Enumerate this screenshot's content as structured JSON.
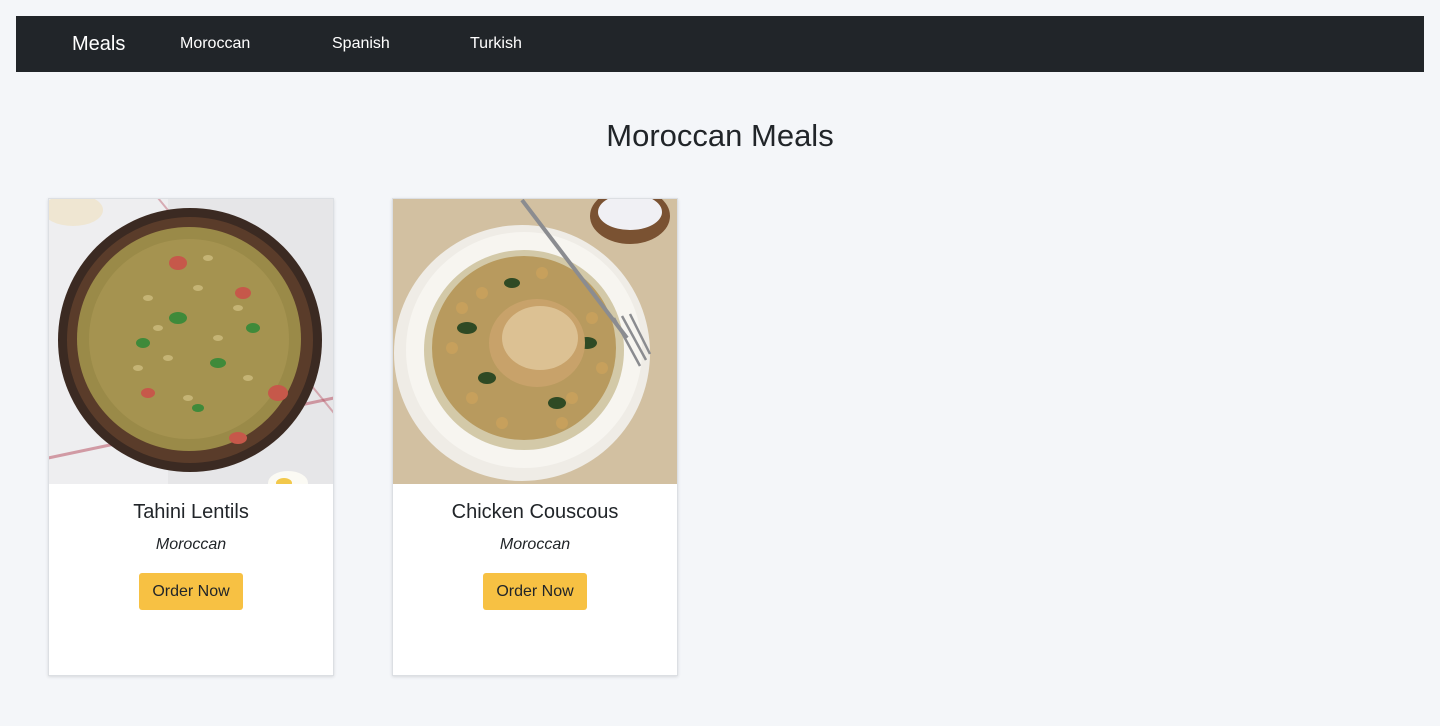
{
  "navbar": {
    "brand": "Meals",
    "links": [
      "Moroccan",
      "Spanish",
      "Turkish"
    ]
  },
  "page": {
    "title": "Moroccan Meals"
  },
  "cards": [
    {
      "title": "Tahini Lentils",
      "cuisine": "Moroccan",
      "button": "Order Now"
    },
    {
      "title": "Chicken Couscous",
      "cuisine": "Moroccan",
      "button": "Order Now"
    }
  ],
  "colors": {
    "navbar_bg": "#212529",
    "page_bg": "#f4f6f9",
    "button_bg": "#f7c143"
  }
}
